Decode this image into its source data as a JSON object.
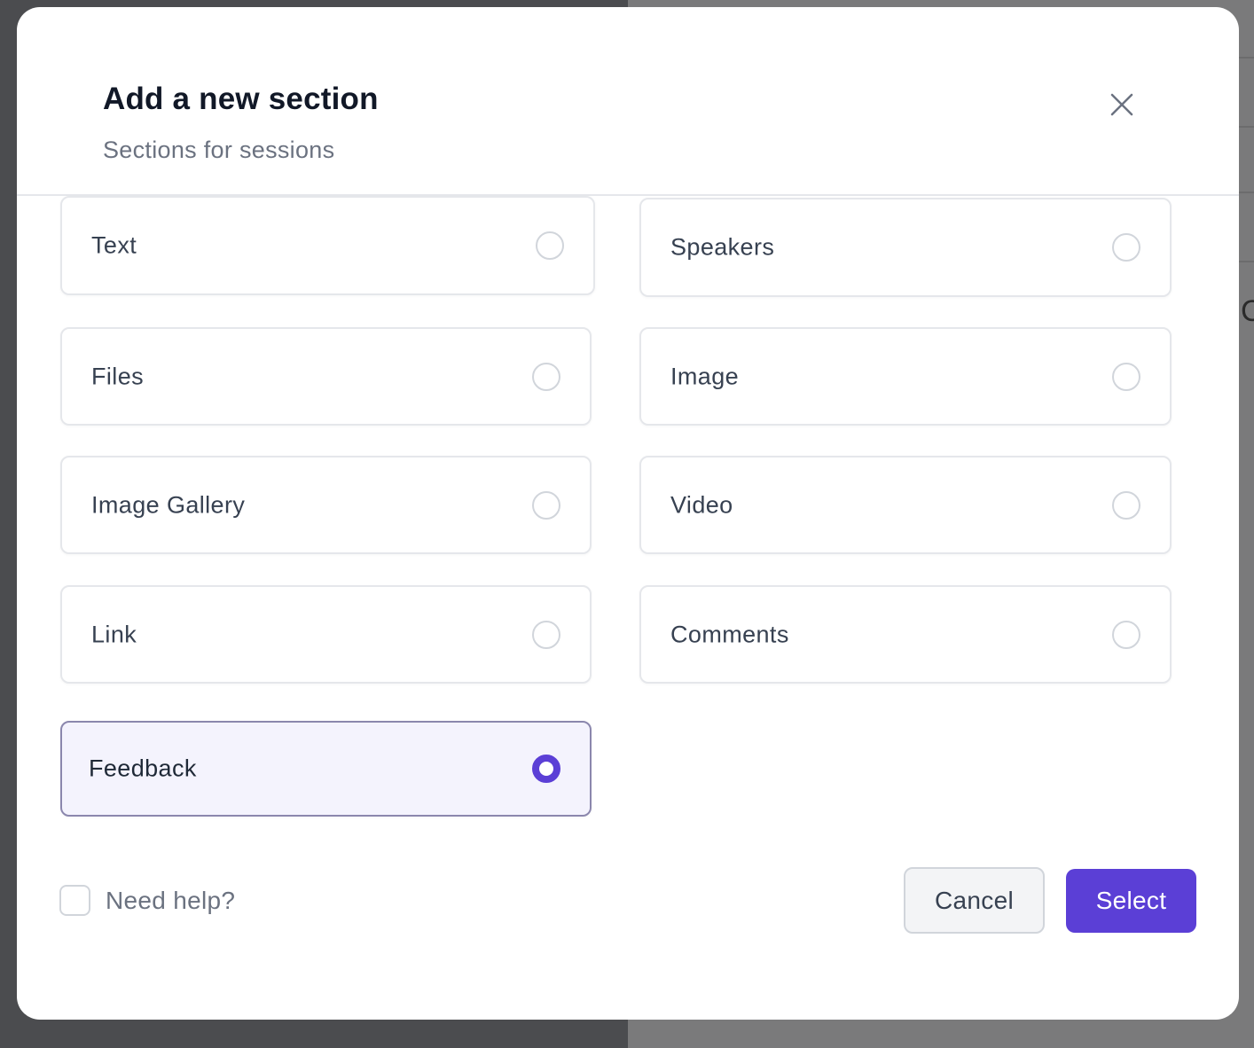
{
  "modal": {
    "title": "Add a new section",
    "subtitle": "Sections for sessions"
  },
  "options": [
    {
      "label": "Text",
      "selected": false
    },
    {
      "label": "Speakers",
      "selected": false
    },
    {
      "label": "Files",
      "selected": false
    },
    {
      "label": "Image",
      "selected": false
    },
    {
      "label": "Image Gallery",
      "selected": false
    },
    {
      "label": "Video",
      "selected": false
    },
    {
      "label": "Link",
      "selected": false
    },
    {
      "label": "Comments",
      "selected": false
    },
    {
      "label": "Feedback",
      "selected": true
    }
  ],
  "footer": {
    "help_label": "Need help?",
    "help_checked": false,
    "cancel_label": "Cancel",
    "select_label": "Select"
  },
  "colors": {
    "accent": "#5b3fd6",
    "selected_background": "#f4f3fd",
    "border": "#e5e7eb"
  },
  "icons": {
    "close": "close-icon"
  }
}
